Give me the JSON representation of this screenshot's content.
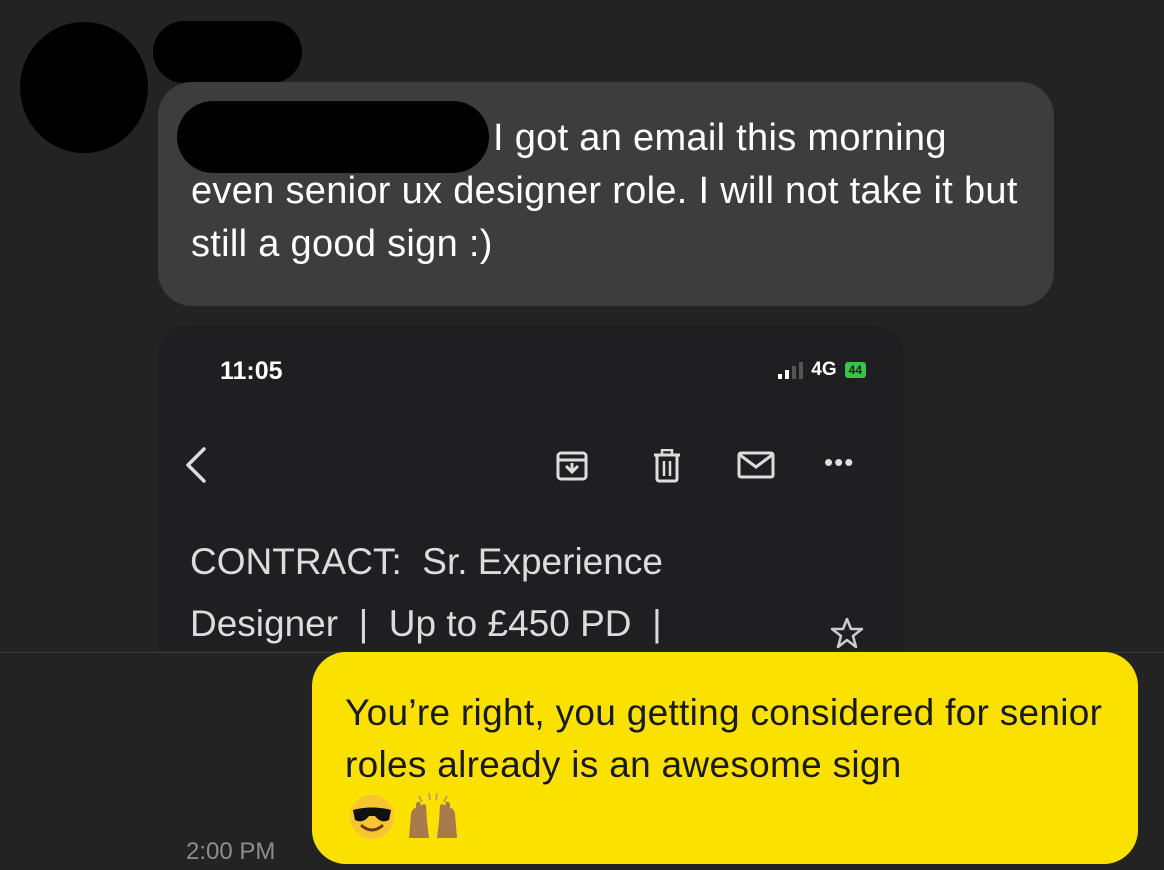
{
  "conversation": {
    "incoming_message": "I got an email this morning even senior ux designer role. I will not take it but still a good sign :)",
    "outgoing_message": "You’re right, you getting considered for senior roles already is an awesome sign",
    "outgoing_emojis": [
      "😎",
      "🙌"
    ],
    "timestamp": "2:00 PM"
  },
  "screenshot": {
    "status_time": "11:05",
    "network": "4G",
    "battery": "44",
    "email_subject_line1": "CONTRACT:  Sr. Experience",
    "email_subject_line2": "Designer  |  Up to £450 PD  |"
  },
  "colors": {
    "background": "#232323",
    "incoming_bubble": "#3d3d3d",
    "outgoing_bubble": "#fae100",
    "battery_green": "#3ac24b"
  },
  "icons": [
    "back-chevron-icon",
    "archive-icon",
    "trash-icon",
    "mail-icon",
    "more-icon",
    "star-icon"
  ]
}
